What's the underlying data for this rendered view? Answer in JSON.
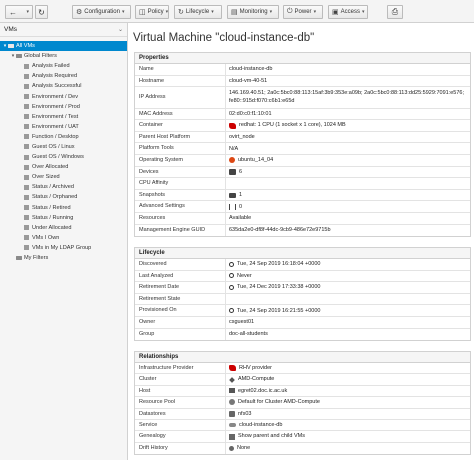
{
  "toolbar": {
    "configuration": "Configuration",
    "policy": "Policy",
    "lifecycle": "Lifecycle",
    "monitoring": "Monitoring",
    "power": "Power",
    "access": "Access"
  },
  "sidebar": {
    "header": "VMs",
    "tree": [
      {
        "label": "All VMs",
        "level": 0,
        "type": "toggle-folder",
        "selected": true
      },
      {
        "label": "Global Filters",
        "level": 1,
        "type": "toggle-folder"
      },
      {
        "label": "Analysis Failed",
        "level": 2,
        "type": "leaf"
      },
      {
        "label": "Analysis Required",
        "level": 2,
        "type": "leaf"
      },
      {
        "label": "Analysis Successful",
        "level": 2,
        "type": "leaf"
      },
      {
        "label": "Environment / Dev",
        "level": 2,
        "type": "leaf"
      },
      {
        "label": "Environment / Prod",
        "level": 2,
        "type": "leaf"
      },
      {
        "label": "Environment / Test",
        "level": 2,
        "type": "leaf"
      },
      {
        "label": "Environment / UAT",
        "level": 2,
        "type": "leaf"
      },
      {
        "label": "Function / Desktop",
        "level": 2,
        "type": "leaf"
      },
      {
        "label": "Guest OS / Linux",
        "level": 2,
        "type": "leaf"
      },
      {
        "label": "Guest OS / Windows",
        "level": 2,
        "type": "leaf"
      },
      {
        "label": "Over Allocated",
        "level": 2,
        "type": "leaf"
      },
      {
        "label": "Over Sized",
        "level": 2,
        "type": "leaf"
      },
      {
        "label": "Status / Archived",
        "level": 2,
        "type": "leaf"
      },
      {
        "label": "Status / Orphaned",
        "level": 2,
        "type": "leaf"
      },
      {
        "label": "Status / Retired",
        "level": 2,
        "type": "leaf"
      },
      {
        "label": "Status / Running",
        "level": 2,
        "type": "leaf"
      },
      {
        "label": "Under Allocated",
        "level": 2,
        "type": "leaf"
      },
      {
        "label": "VMs I Own",
        "level": 2,
        "type": "leaf"
      },
      {
        "label": "VMs in My LDAP Group",
        "level": 2,
        "type": "leaf"
      },
      {
        "label": "My Filters",
        "level": 1,
        "type": "folder"
      }
    ]
  },
  "page": {
    "title": "Virtual Machine \"cloud-instance-db\""
  },
  "properties": {
    "title": "Properties",
    "rows": [
      {
        "key": "Name",
        "value": "cloud-instance-db"
      },
      {
        "key": "Hostname",
        "value": "cloud-vm-40-51"
      },
      {
        "key": "IP Address",
        "value": "146.169.40.51; 2a0c:5bc0:88:113:15af:3b9:353e:a09b; 2a0c:5bc0:88:113:dd25:5929:7091:e576; fe80::915d:f070:c6b1:e65d",
        "tall": true
      },
      {
        "key": "MAC Address",
        "value": "02:d0:c0:f1:10:01"
      },
      {
        "key": "Container",
        "value": "redhat: 1 CPU (1 socket x 1 core), 1024 MB",
        "icon": "redhat-icon"
      },
      {
        "key": "Parent Host Platform",
        "value": "ovirt_node"
      },
      {
        "key": "Platform Tools",
        "value": "N/A"
      },
      {
        "key": "Operating System",
        "value": "ubuntu_14_04",
        "icon": "ubuntu-icon"
      },
      {
        "key": "Devices",
        "value": "6",
        "icon": "devices-icon"
      },
      {
        "key": "CPU Affinity",
        "value": ""
      },
      {
        "key": "Snapshots",
        "value": "1",
        "icon": "camera-icon"
      },
      {
        "key": "Advanced Settings",
        "value": "0",
        "icon": "sliders-icon"
      },
      {
        "key": "Resources",
        "value": "Available"
      },
      {
        "key": "Management Engine GUID",
        "value": "635da2e0-df8f-44dc-9cb9-486e72e9715b"
      }
    ]
  },
  "lifecycle": {
    "title": "Lifecycle",
    "rows": [
      {
        "key": "Discovered",
        "value": "Tue, 24 Sep 2019 16:18:04 +0000",
        "icon": "search-icon"
      },
      {
        "key": "Last Analyzed",
        "value": "Never",
        "icon": "search-icon"
      },
      {
        "key": "Retirement Date",
        "value": "Tue, 24 Dec 2019 17:33:38 +0000",
        "icon": "clock-icon"
      },
      {
        "key": "Retirement State",
        "value": ""
      },
      {
        "key": "Provisioned On",
        "value": "Tue, 24 Sep 2019 16:21:55 +0000",
        "icon": "clock-icon"
      },
      {
        "key": "Owner",
        "value": "csguest01"
      },
      {
        "key": "Group",
        "value": "doc-all-students"
      }
    ]
  },
  "relationships": {
    "title": "Relationships",
    "rows": [
      {
        "key": "Infrastructure Provider",
        "value": "RHV provider",
        "icon": "provider-icon"
      },
      {
        "key": "Cluster",
        "value": "AMD-Compute",
        "icon": "cluster-icon"
      },
      {
        "key": "Host",
        "value": "egret02.doc.ic.ac.uk",
        "icon": "host-icon"
      },
      {
        "key": "Resource Pool",
        "value": "Default for Cluster AMD-Compute",
        "icon": "pool-icon"
      },
      {
        "key": "Datastores",
        "value": "nfs03",
        "icon": "datastore-icon"
      },
      {
        "key": "Service",
        "value": "cloud-instance-db",
        "icon": "service-icon"
      },
      {
        "key": "Genealogy",
        "value": "Show parent and child VMs",
        "icon": "genealogy-icon"
      },
      {
        "key": "Drift History",
        "value": "None",
        "icon": "drift-icon"
      }
    ]
  }
}
